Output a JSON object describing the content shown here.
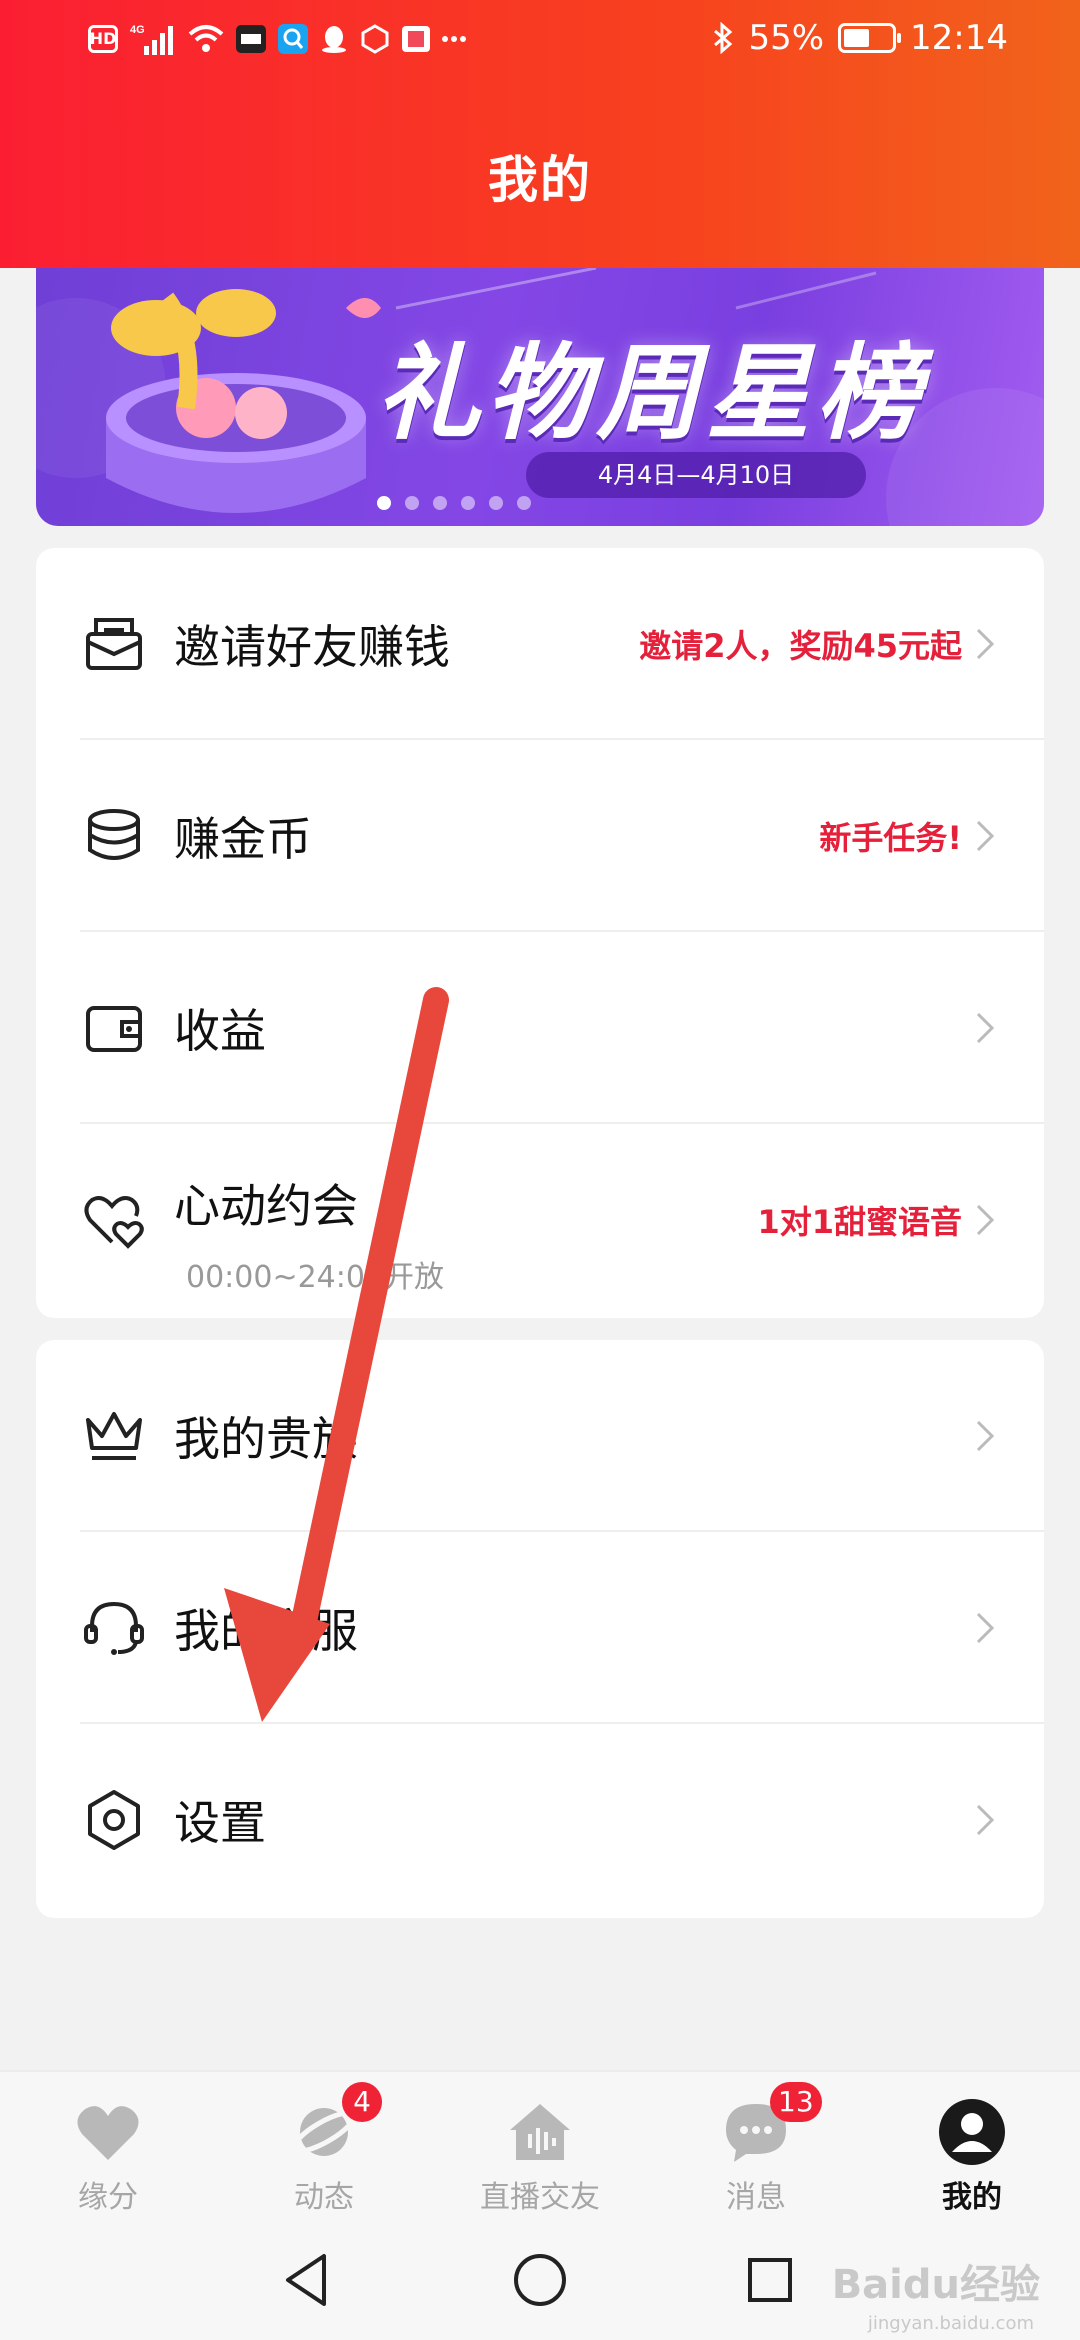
{
  "status_bar": {
    "network": "4G",
    "battery": "55%",
    "battery_level": 0.55,
    "time": "12:14"
  },
  "header": {
    "title": "我的"
  },
  "banner": {
    "title": "礼物周星榜",
    "date_range": "4月4日—4月10日",
    "page_count": 6,
    "active_page": 1
  },
  "menu_group_1": [
    {
      "label": "邀请好友赚钱",
      "hint": "邀请2人，奖励45元起",
      "icon": "invite-envelope-icon"
    },
    {
      "label": "赚金币",
      "hint": "新手任务!",
      "icon": "coins-stack-icon"
    },
    {
      "label": "收益",
      "hint": "",
      "icon": "wallet-icon"
    },
    {
      "label": "心动约会",
      "sub": "00:00~24:00开放",
      "hint": "1对1甜蜜语音",
      "icon": "double-heart-icon"
    }
  ],
  "menu_group_2": [
    {
      "label": "我的贵族",
      "icon": "crown-icon"
    },
    {
      "label": "我的客服",
      "icon": "headset-icon"
    },
    {
      "label": "设置",
      "icon": "settings-hexagon-icon"
    }
  ],
  "tabbar": [
    {
      "label": "缘分",
      "icon": "heart-icon",
      "badge": ""
    },
    {
      "label": "动态",
      "icon": "planet-icon",
      "badge": "4"
    },
    {
      "label": "直播交友",
      "icon": "live-house-icon",
      "badge": ""
    },
    {
      "label": "消息",
      "icon": "chat-bubble-icon",
      "badge": "13"
    },
    {
      "label": "我的",
      "icon": "profile-avatar-icon",
      "badge": "",
      "active": true
    }
  ],
  "watermark": {
    "text": "Baidu经验",
    "sub": "jingyan.baidu.com"
  },
  "colors": {
    "header_start": "#fb1e33",
    "header_end": "#f1631b",
    "accent_red": "#e5203a",
    "badge_red": "#f02235",
    "annotation_arrow": "#e8473b"
  }
}
